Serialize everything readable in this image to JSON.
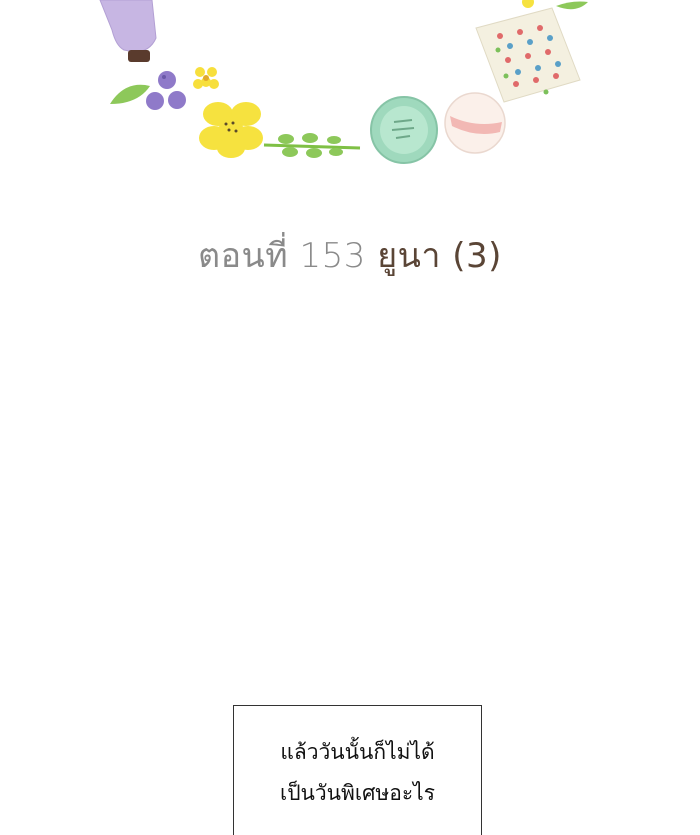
{
  "title": {
    "episode_label": "ตอนที่ 153",
    "chapter_name": "ยูนา",
    "part": "(3)"
  },
  "caption": {
    "line1": "แล้ววันนั้นก็ไม่ได้",
    "line2": "เป็นวันพิเศษอะไร"
  }
}
